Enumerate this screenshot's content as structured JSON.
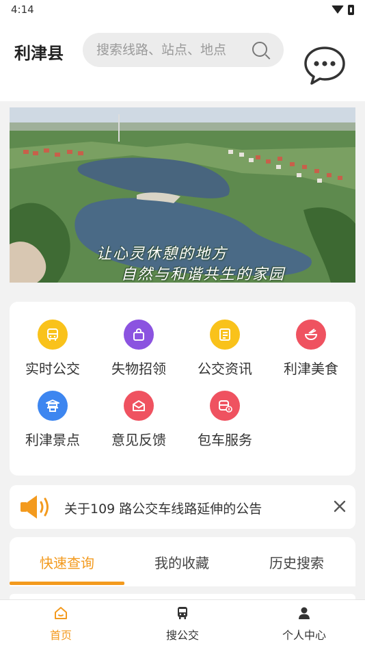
{
  "status_bar": {
    "time": "4:14"
  },
  "header": {
    "county": "利津县",
    "search_placeholder": "搜索线路、站点、地点"
  },
  "banner": {
    "caption_line1": "让心灵休憩的地方",
    "caption_line2": "自然与和谐共生的家园"
  },
  "grid": {
    "items": [
      {
        "label": "实时公交",
        "icon": "bus-icon",
        "color": "#f9c21b"
      },
      {
        "label": "失物招领",
        "icon": "bag-icon",
        "color": "#8b53e0"
      },
      {
        "label": "公交资讯",
        "icon": "news-icon",
        "color": "#f9c21b"
      },
      {
        "label": "利津美食",
        "icon": "food-bowl-icon",
        "color": "#ef5260"
      },
      {
        "label": "利津景点",
        "icon": "pagoda-icon",
        "color": "#3d86f0"
      },
      {
        "label": "意见反馈",
        "icon": "mail-icon",
        "color": "#ef5260"
      },
      {
        "label": "包车服务",
        "icon": "charter-bus-icon",
        "color": "#ef5260"
      }
    ]
  },
  "notice": {
    "text": "关于109 路公交车线路延伸的公告"
  },
  "tabs": [
    {
      "label": "快速查询",
      "active": true
    },
    {
      "label": "我的收藏",
      "active": false
    },
    {
      "label": "历史搜索",
      "active": false
    }
  ],
  "bottom_nav": [
    {
      "label": "首页",
      "icon": "home-icon",
      "active": true
    },
    {
      "label": "搜公交",
      "icon": "bus-icon",
      "active": false
    },
    {
      "label": "个人中心",
      "icon": "person-icon",
      "active": false
    }
  ],
  "colors": {
    "accent": "#f39a1e",
    "background": "#f2f2f2"
  }
}
